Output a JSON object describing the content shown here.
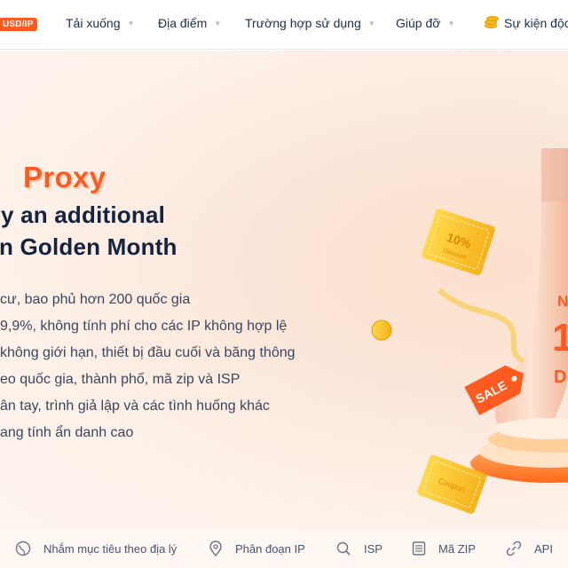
{
  "nav": {
    "badge": "USD/IP",
    "items": [
      {
        "label": "Tải xuống"
      },
      {
        "label": "Địa điểm"
      },
      {
        "label": "Trường hợp sử dụng"
      },
      {
        "label": "Giúp đỡ"
      }
    ],
    "event_label": "Sự kiện độc"
  },
  "hero": {
    "brand": "Proxy",
    "headline_1": "y an additional",
    "headline_2": "n Golden Month",
    "features": [
      "cư, bao phủ hơn 200 quốc gia",
      "9,9%, không tính phí cho các IP không hợp lệ",
      "không giới hạn, thiết bị đầu cuối và băng thông",
      "eo quốc gia, thành phố, mã zip và ISP",
      "ân tay, trình giả lập và các tình huống khác",
      "ang tính ẩn danh cao"
    ],
    "promo": {
      "discount_ticket": "10%",
      "discount_word": "Discount",
      "sale_tag": "SALE",
      "coupon": "Coupon",
      "partial_1": "N",
      "partial_2": "1",
      "partial_3": "D"
    }
  },
  "bottom_links": [
    {
      "label": "Nhắm mục tiêu theo địa lý",
      "icon": "globe-icon"
    },
    {
      "label": "Phân đoạn IP",
      "icon": "location-pin-icon"
    },
    {
      "label": "ISP",
      "icon": "search-icon"
    },
    {
      "label": "Mã ZIP",
      "icon": "zip-list-icon"
    },
    {
      "label": "API",
      "icon": "link-icon"
    }
  ],
  "colors": {
    "accent": "#ff5a1f",
    "headline": "#14233f",
    "hero_bg": "#fbe7da"
  }
}
